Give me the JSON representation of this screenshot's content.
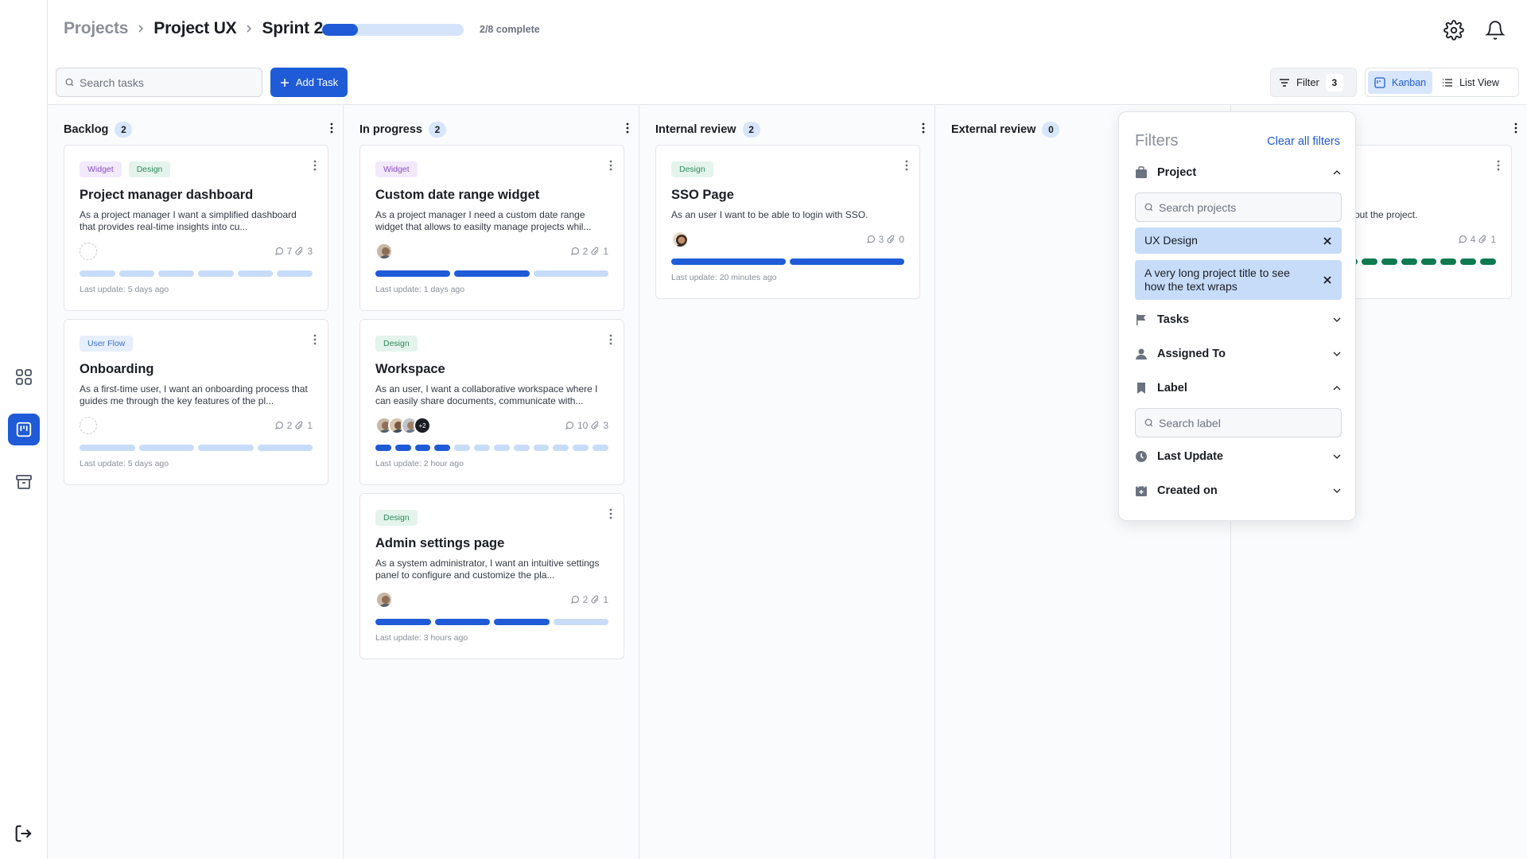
{
  "breadcrumb": {
    "root": "Projects",
    "project": "Project UX",
    "current": "Sprint 2"
  },
  "progress": {
    "fraction": 0.25,
    "label": "2/8 complete"
  },
  "toolbar": {
    "search_placeholder": "Search tasks",
    "add_label": "Add Task",
    "filter_label": "Filter",
    "filter_count": "3",
    "kanban_label": "Kanban",
    "list_label": "List View"
  },
  "columns": [
    {
      "title": "Backlog",
      "count": "2"
    },
    {
      "title": "In progress",
      "count": "2"
    },
    {
      "title": "Internal review",
      "count": "2"
    },
    {
      "title": "External review",
      "count": "0"
    }
  ],
  "cards": {
    "backlog": [
      {
        "tags": [
          "Widget",
          "Design"
        ],
        "title": "Project manager dashboard",
        "desc": "As a project manager  I want a simplified dashboard that provides real-time insights into cu...",
        "comments": "7",
        "attachments": "3",
        "footer": "Last update: 5 days ago"
      },
      {
        "tags": [
          "User Flow"
        ],
        "title": "Onboarding",
        "desc": "As a first-time user, I want an onboarding process that guides me through the key features of the pl...",
        "comments": "2",
        "attachments": "1",
        "footer": "Last update: 5 days ago"
      }
    ],
    "progress": [
      {
        "tags": [
          "Widget"
        ],
        "title": "Custom date range widget",
        "desc": "As a project manager I need a custom date range widget that allows to easilty manage projects whil...",
        "comments": "2",
        "attachments": "1",
        "footer": "Last update: 1 days ago"
      },
      {
        "tags": [
          "Design"
        ],
        "title": "Workspace",
        "desc": "As an user, I want a collaborative workspace where I can easily share documents, communicate with...",
        "comments": "10",
        "attachments": "3",
        "more": "+2",
        "footer": "Last update: 2 hour ago"
      },
      {
        "tags": [
          "Design"
        ],
        "title": "Admin settings page",
        "desc": "As a system administrator, I want an intuitive settings panel to configure and customize the pla...",
        "comments": "2",
        "attachments": "1",
        "footer": "Last update: 3 hours ago"
      }
    ],
    "review": [
      {
        "tags": [
          "Design"
        ],
        "title": "SSO Page",
        "desc": "As an user I want to be able to login with SSO.",
        "comments": "3",
        "attachments": "0",
        "footer": "Last update: 20 minutes ago"
      }
    ],
    "done": [
      {
        "desc": "out the project.",
        "comments": "4",
        "attachments": "1"
      }
    ]
  },
  "filters": {
    "title": "Filters",
    "clear": "Clear all filters",
    "project": {
      "label": "Project",
      "placeholder": "Search projects",
      "chips": [
        "UX Design",
        "A very long project title to see how the text wraps"
      ]
    },
    "tasks": "Tasks",
    "assigned": "Assigned To",
    "label": {
      "label": "Label",
      "placeholder": "Search label"
    },
    "last_update": "Last Update",
    "created": "Created on"
  },
  "colors": {
    "accent": "#1f5bd6",
    "light_accent": "#c7dcf8",
    "done": "#0f7a4f"
  }
}
